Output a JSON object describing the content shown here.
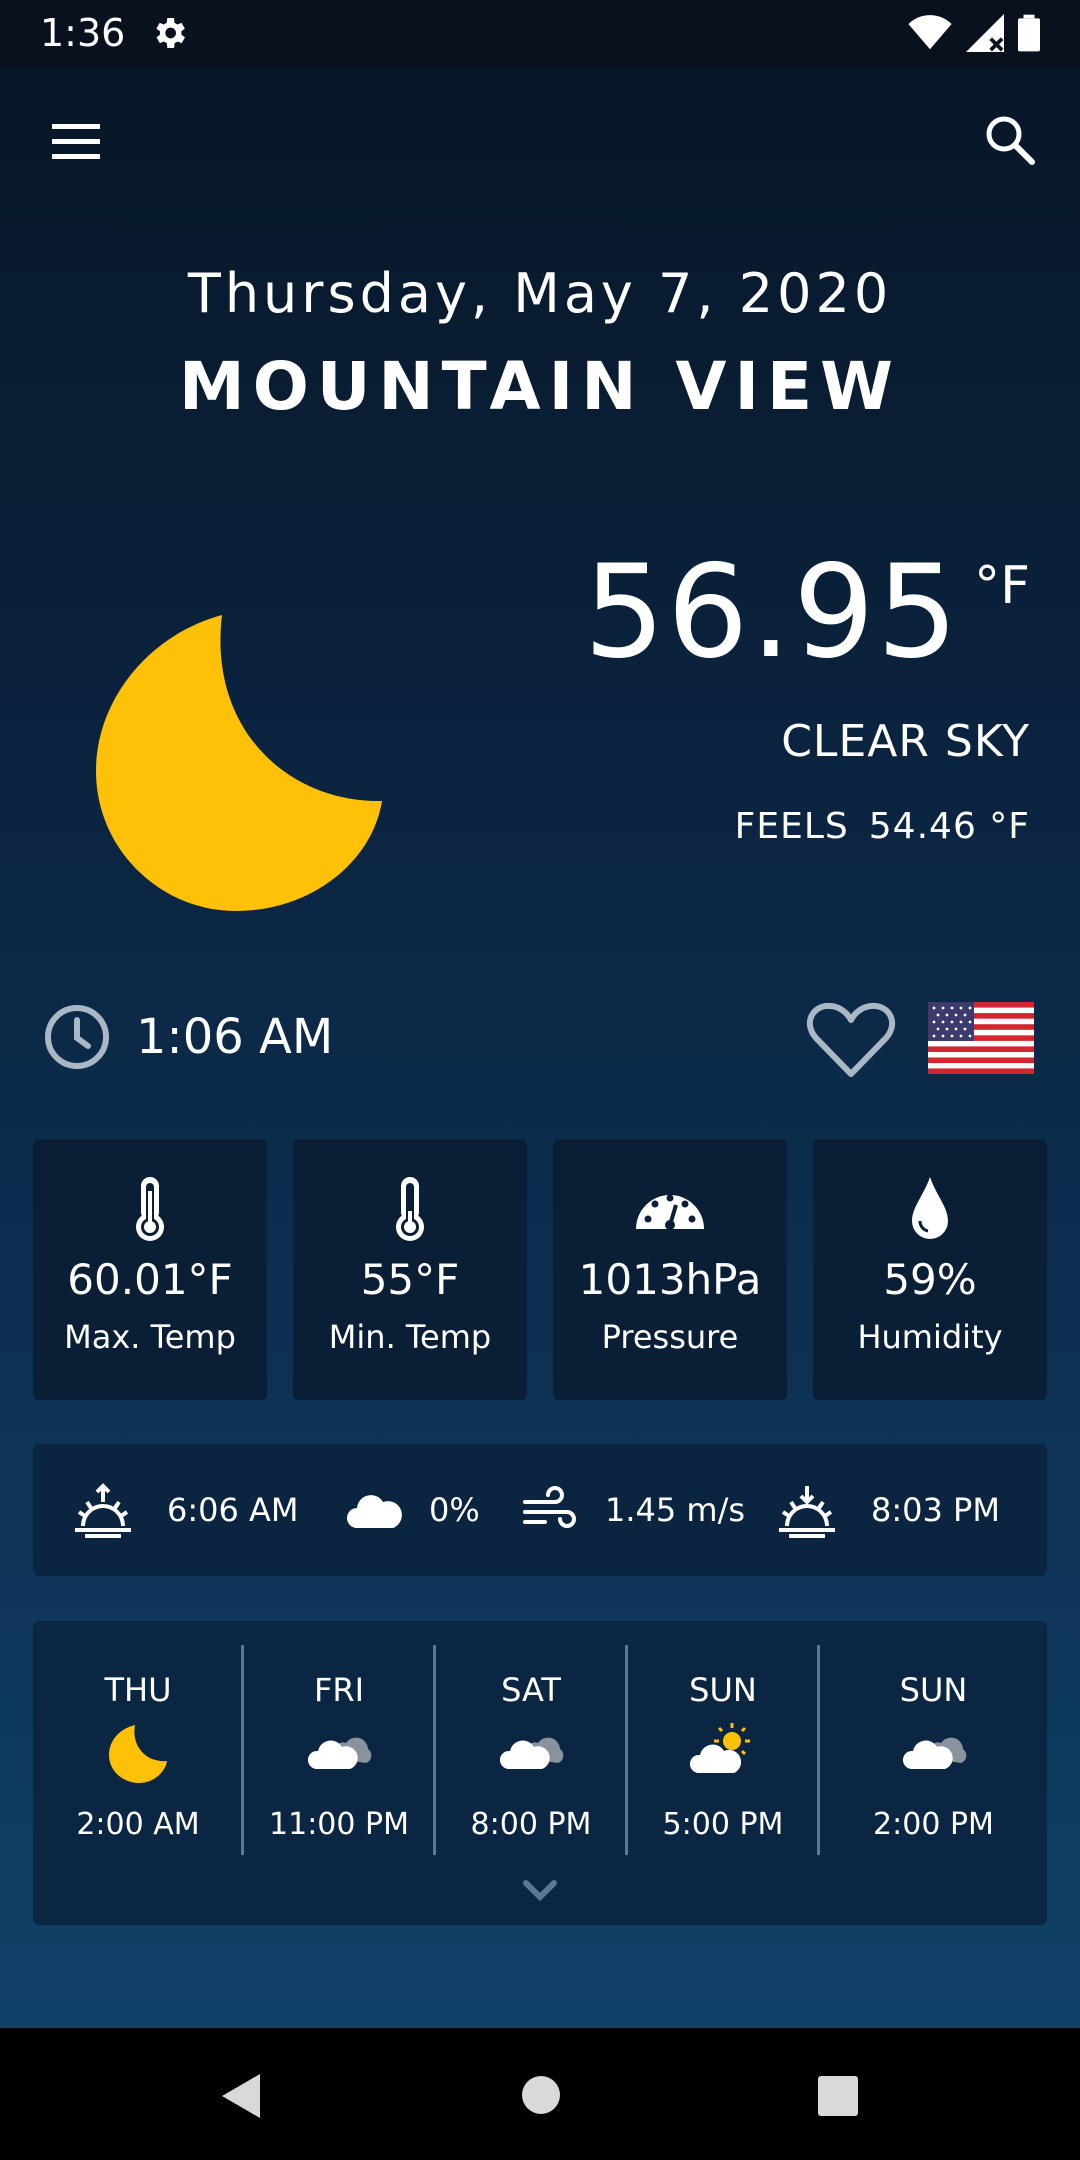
{
  "status": {
    "time": "1:36"
  },
  "header": {
    "date": "Thursday, May 7, 2020",
    "city": "MOUNTAIN VIEW"
  },
  "current": {
    "temperature": "56.95",
    "unit": "°F",
    "condition": "CLEAR SKY",
    "feels_label": "FEELS",
    "feels_value": "54.46 °F",
    "local_time": "1:06 AM"
  },
  "stats": [
    {
      "icon": "thermometer-high-icon",
      "value": "60.01°F",
      "label": "Max. Temp"
    },
    {
      "icon": "thermometer-low-icon",
      "value": "55°F",
      "label": "Min. Temp"
    },
    {
      "icon": "gauge-icon",
      "value": "1013hPa",
      "label": "Pressure"
    },
    {
      "icon": "drop-icon",
      "value": "59%",
      "label": "Humidity"
    }
  ],
  "sunbar": {
    "sunrise": "6:06 AM",
    "clouds": "0%",
    "wind": "1.45 m/s",
    "sunset": "8:03 PM"
  },
  "forecast": [
    {
      "day": "THU",
      "icon": "moon-icon",
      "time": "2:00 AM"
    },
    {
      "day": "FRI",
      "icon": "cloudy-icon",
      "time": "11:00 PM"
    },
    {
      "day": "SAT",
      "icon": "cloudy-icon",
      "time": "8:00 PM"
    },
    {
      "day": "SUN",
      "icon": "partly-sunny-icon",
      "time": "5:00 PM"
    },
    {
      "day": "SUN",
      "icon": "cloudy-icon",
      "time": "2:00 PM"
    }
  ],
  "colors": {
    "moon": "#FFC107",
    "card": "#0a1f36",
    "divider": "#5d7691"
  }
}
